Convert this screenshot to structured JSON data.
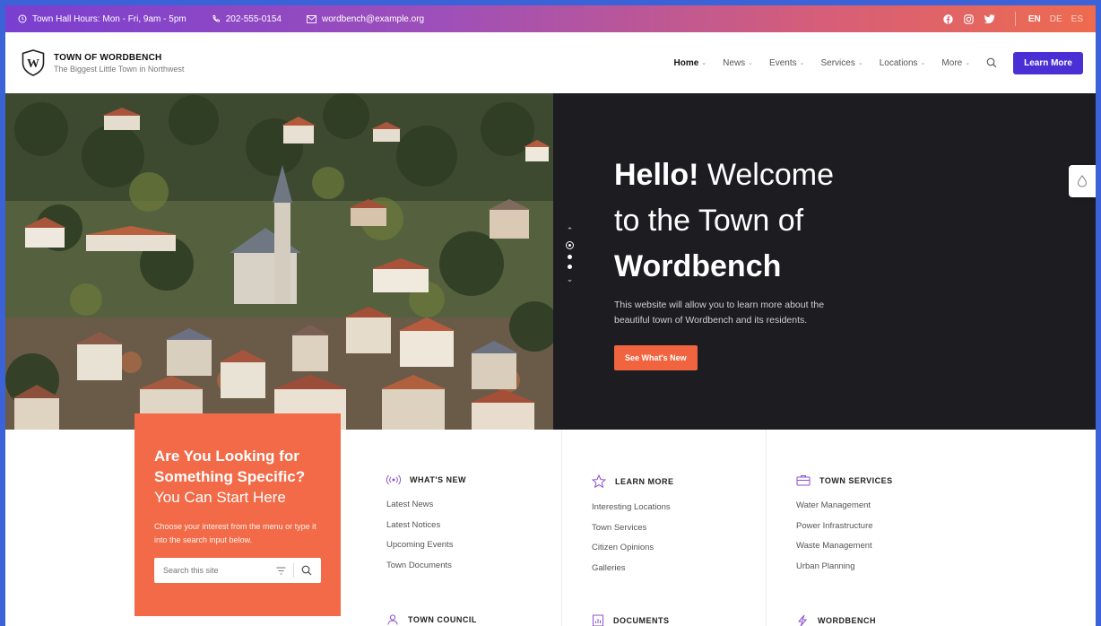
{
  "topbar": {
    "hours": "Town Hall Hours: Mon - Fri, 9am - 5pm",
    "phone": "202-555-0154",
    "email": "wordbench@example.org",
    "languages": [
      "EN",
      "DE",
      "ES"
    ]
  },
  "header": {
    "site_name": "TOWN OF WORDBENCH",
    "tagline": "The Biggest Little Town in Northwest",
    "nav": [
      "Home",
      "News",
      "Events",
      "Services",
      "Locations",
      "More"
    ],
    "cta": "Learn More"
  },
  "hero": {
    "title_bold_1": "Hello!",
    "title_rest_1": "Welcome",
    "title_line_2": "to the Town of",
    "title_bold_3": "Wordbench",
    "description": "This website will allow you to learn more about the beautiful town of Wordbench and its residents.",
    "button": "See What's New",
    "slide_count": 3,
    "active_slide": 1
  },
  "search_card": {
    "title_bold": "Are You Looking for Something Specific?",
    "title_light": "You Can Start Here",
    "text": "Choose your interest from the menu or type it into the search input below.",
    "placeholder": "Search this site"
  },
  "columns": [
    {
      "title": "WHAT'S NEW",
      "icon": "broadcast-icon",
      "links": [
        "Latest News",
        "Latest Notices",
        "Upcoming Events",
        "Town Documents"
      ],
      "next_title": "TOWN COUNCIL",
      "next_icon": "person-icon"
    },
    {
      "title": "LEARN MORE",
      "icon": "star-icon",
      "links": [
        "Interesting Locations",
        "Town Services",
        "Citizen Opinions",
        "Galleries"
      ],
      "next_title": "DOCUMENTS",
      "next_icon": "document-chart-icon"
    },
    {
      "title": "TOWN SERVICES",
      "icon": "briefcase-icon",
      "links": [
        "Water Management",
        "Power Infrastructure",
        "Waste Management",
        "Urban Planning"
      ],
      "next_title": "WORDBENCH",
      "next_icon": "bolt-icon"
    }
  ],
  "colors": {
    "accent_purple": "#4a2fd4",
    "accent_orange": "#f26a47",
    "hero_dark": "#1c1c21",
    "icon_purple": "#8b4fd0"
  }
}
